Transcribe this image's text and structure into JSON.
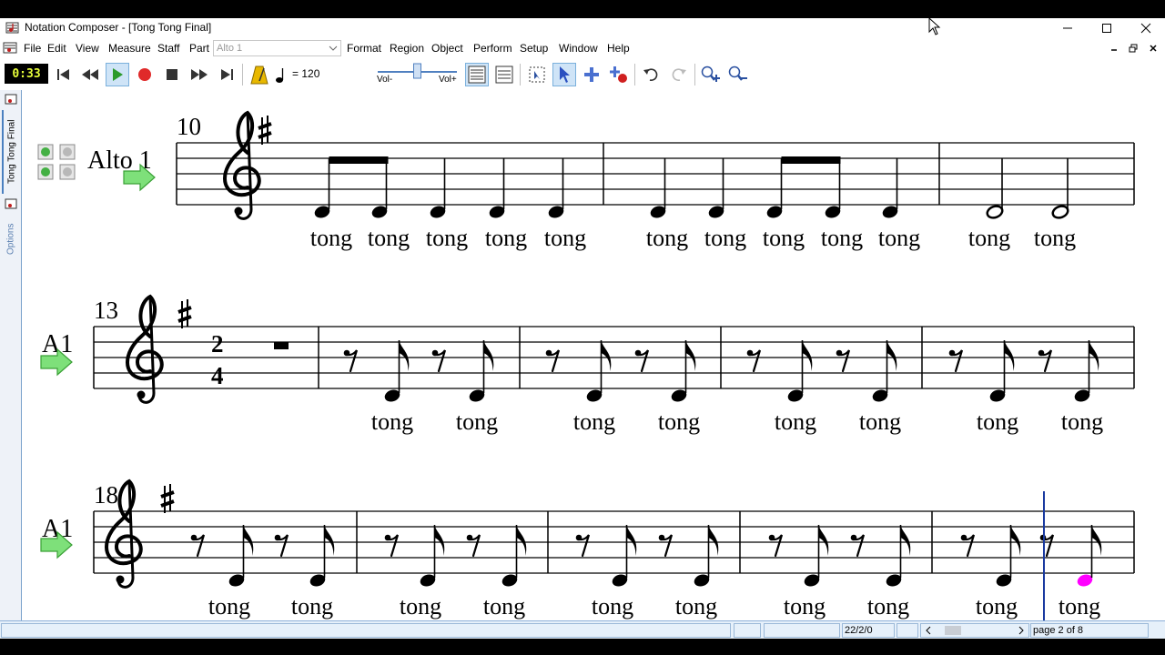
{
  "window": {
    "title": "Notation Composer - [Tong Tong Final]"
  },
  "menu": {
    "items": [
      "File",
      "Edit",
      "View",
      "Measure",
      "Staff",
      "Part"
    ],
    "items2": [
      "Format",
      "Region",
      "Object",
      "Perform",
      "Setup",
      "Window",
      "Help"
    ],
    "part_value": "Alto 1"
  },
  "toolbar": {
    "time": "0:33",
    "tempo": "= 120",
    "vol_minus": "Vol-",
    "vol_plus": "Vol+",
    "volume_level": 0.5
  },
  "sidepanel": {
    "tab1": "Tong Tong Final",
    "tab2": "Options"
  },
  "score": {
    "staff1_name": "Alto 1",
    "staff_short_name": "A1",
    "system1_measure": "10",
    "system2_measure": "13",
    "system3_measure": "18",
    "time_sig_top": "2",
    "time_sig_bottom": "4",
    "lyric": "tong",
    "highlight_color": "#ff00ff",
    "highlight_lyric_color": "#e0201e"
  },
  "status": {
    "position": "22/2/0",
    "page": "page 2 of 8"
  }
}
